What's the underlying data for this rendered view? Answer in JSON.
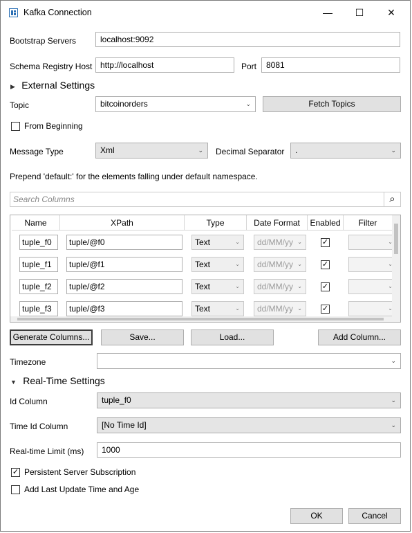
{
  "window": {
    "title": "Kafka Connection",
    "controls": {
      "minimize": "—",
      "maximize": "☐",
      "close": "✕"
    }
  },
  "bootstrap": {
    "label": "Bootstrap Servers",
    "value": "localhost:9092"
  },
  "schema_registry": {
    "label": "Schema Registry Host",
    "value": "http://localhost",
    "port_label": "Port",
    "port_value": "8081"
  },
  "external_settings": {
    "label": "External Settings"
  },
  "topic": {
    "label": "Topic",
    "value": "bitcoinorders",
    "fetch_label": "Fetch Topics"
  },
  "from_beginning": {
    "label": "From Beginning",
    "checked": false
  },
  "message_type": {
    "label": "Message Type",
    "value": "Xml",
    "decimal_label": "Decimal Separator",
    "decimal_value": "."
  },
  "hint": "Prepend 'default:' for the elements falling under default namespace.",
  "search": {
    "placeholder": "Search Columns"
  },
  "columns_grid": {
    "headers": [
      "Name",
      "XPath",
      "Type",
      "Date Format",
      "Enabled",
      "Filter"
    ],
    "rows": [
      {
        "name": "tuple_f0",
        "xpath": "tuple/@f0",
        "type": "Text",
        "date_format": "dd/MM/yy",
        "enabled": true
      },
      {
        "name": "tuple_f1",
        "xpath": "tuple/@f1",
        "type": "Text",
        "date_format": "dd/MM/yy",
        "enabled": true
      },
      {
        "name": "tuple_f2",
        "xpath": "tuple/@f2",
        "type": "Text",
        "date_format": "dd/MM/yy",
        "enabled": true
      },
      {
        "name": "tuple_f3",
        "xpath": "tuple/@f3",
        "type": "Text",
        "date_format": "dd/MM/yy",
        "enabled": true
      }
    ]
  },
  "buttons": {
    "generate": "Generate Columns...",
    "save": "Save...",
    "load": "Load...",
    "add_column": "Add Column..."
  },
  "timezone": {
    "label": "Timezone",
    "value": ""
  },
  "realtime": {
    "label": "Real-Time Settings"
  },
  "id_column": {
    "label": "Id Column",
    "value": "tuple_f0"
  },
  "time_id_column": {
    "label": "Time Id Column",
    "value": "[No Time Id]"
  },
  "realtime_limit": {
    "label": "Real-time Limit (ms)",
    "value": "1000"
  },
  "persistent": {
    "label": "Persistent Server Subscription",
    "checked": true
  },
  "add_last_update": {
    "label": "Add Last Update Time and Age",
    "checked": false
  },
  "footer": {
    "ok": "OK",
    "cancel": "Cancel"
  },
  "glyphs": {
    "chevron": "⌄",
    "check": "✓",
    "expander_collapsed": "▶",
    "expander_expanded": "▼",
    "search_icon": "⌕"
  }
}
